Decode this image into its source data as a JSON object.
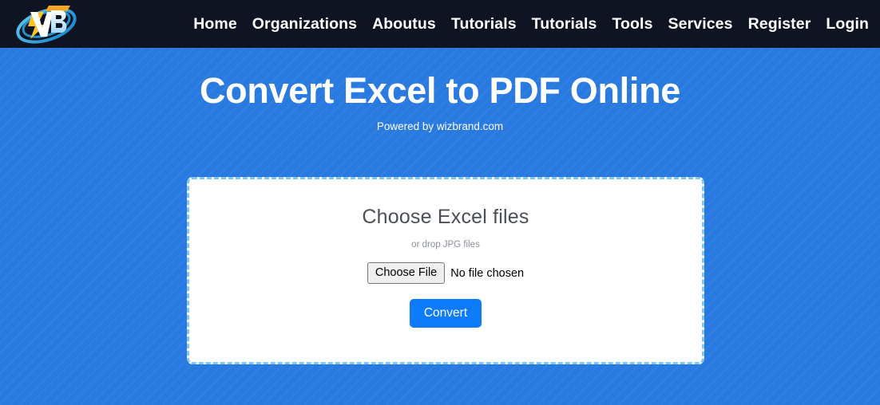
{
  "navbar": {
    "background_color": "#0e1421",
    "logo": {
      "name": "wizbrand-logo",
      "letters": "WB",
      "colors": {
        "orbit": "#2ba5e8",
        "w_fill": "#ffffff",
        "bolt": "#fdc325",
        "b_fill": "#bfe4f8",
        "accent": "#f5a623"
      }
    },
    "links": [
      {
        "label": "Home"
      },
      {
        "label": "Organizations"
      },
      {
        "label": "Aboutus"
      },
      {
        "label": "Tutorials"
      },
      {
        "label": "Tutorials"
      },
      {
        "label": "Tools"
      },
      {
        "label": "Services"
      },
      {
        "label": "Register"
      },
      {
        "label": "Login"
      }
    ]
  },
  "hero": {
    "title": "Convert Excel to PDF Online",
    "subtitle": "Powered by wizbrand.com",
    "background_color": "#2879e0"
  },
  "upload_card": {
    "title": "Choose Excel files",
    "hint": "or drop JPG files",
    "file_input": {
      "button_label": "Choose File",
      "file_status": "No file chosen"
    },
    "submit": {
      "label": "Convert",
      "color": "#0d7bfc"
    },
    "border_color": "#7ec8f5"
  }
}
